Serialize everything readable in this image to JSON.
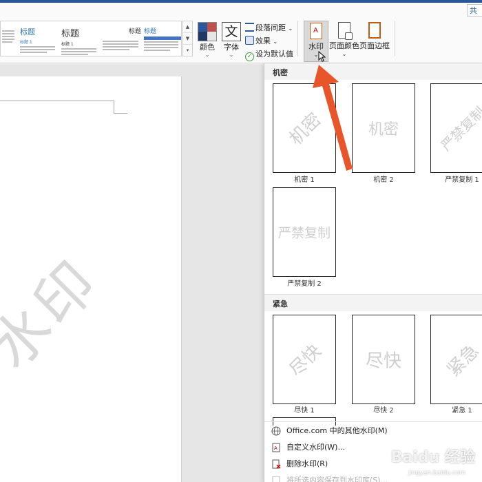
{
  "ribbon": {
    "share_label": "共",
    "styles": [
      {
        "title": "",
        "sub": ""
      },
      {
        "title": "标题",
        "sub": "标题 1"
      },
      {
        "title": "标题",
        "sub": "标题 1"
      },
      {
        "title": "标题",
        "sub": ""
      },
      {
        "title": "标题",
        "sub": "标题"
      }
    ],
    "colors_label": "颜色",
    "fonts_label": "字体",
    "fonts_glyph": "文",
    "paragraph_spacing_label": "段落间距",
    "effects_label": "效果",
    "set_default_label": "设为默认值",
    "watermark_label": "水印",
    "page_color_label": "页面颜色",
    "page_borders_label": "页面边框",
    "colors": {
      "blue": "#2b579a",
      "red": "#c0504d",
      "gray": "#7f7f7f",
      "dark": "#1f3864",
      "accent": "#e8552a"
    }
  },
  "document": {
    "watermark_text": "水印"
  },
  "panel": {
    "sections": [
      {
        "header": "机密",
        "items": [
          {
            "label": "机密 1",
            "wm": "机密",
            "style": "diagonal"
          },
          {
            "label": "机密 2",
            "wm": "机密",
            "style": "flat"
          },
          {
            "label": "严禁复制 1",
            "wm": "严禁复制",
            "style": "diagonal"
          },
          {
            "label": "严禁复制 2",
            "wm": "严禁复制",
            "style": "flat"
          }
        ]
      },
      {
        "header": "紧急",
        "items": [
          {
            "label": "尽快 1",
            "wm": "尽快",
            "style": "diagonal"
          },
          {
            "label": "尽快 2",
            "wm": "尽快",
            "style": "flat"
          },
          {
            "label": "紧急 1",
            "wm": "紧急",
            "style": "diagonal"
          }
        ]
      }
    ],
    "menu": [
      {
        "label": "Office.com 中的其他水印(M)",
        "icon": "globe-icon",
        "disabled": false
      },
      {
        "label": "自定义水印(W)...",
        "icon": "custom-watermark-icon",
        "disabled": false
      },
      {
        "label": "删除水印(R)",
        "icon": "remove-watermark-icon",
        "disabled": false
      },
      {
        "label": "将所选内容保存到水印库(S)...",
        "icon": "save-gallery-icon",
        "disabled": true
      }
    ]
  },
  "brand": {
    "text": "Baidu 经验",
    "sub": "jingyan.baidu.com"
  }
}
